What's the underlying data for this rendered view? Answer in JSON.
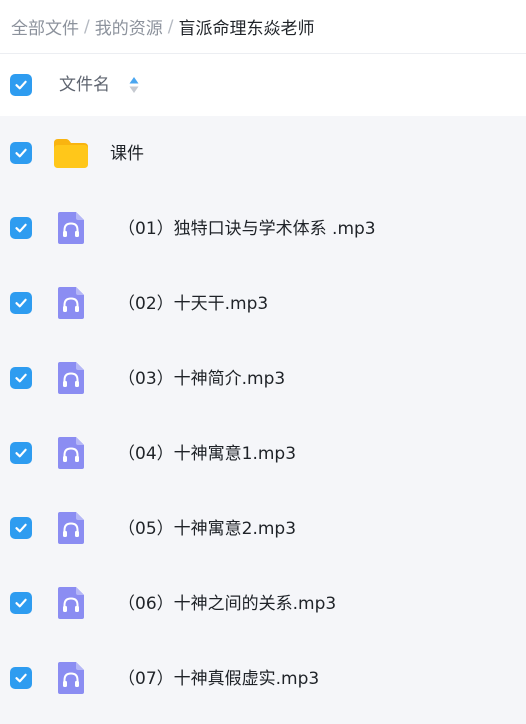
{
  "breadcrumb": {
    "items": [
      "全部文件",
      "我的资源"
    ],
    "current": "盲派命理东焱老师",
    "separator": "/"
  },
  "table": {
    "column_name": "文件名",
    "header_checked": true
  },
  "files": [
    {
      "name": "课件",
      "type": "folder",
      "checked": true,
      "icon": "folder-icon"
    },
    {
      "name": "（01）独特口诀与学术体系 .mp3",
      "type": "audio",
      "checked": true,
      "icon": "audio-file-icon"
    },
    {
      "name": "（02）十天干.mp3",
      "type": "audio",
      "checked": true,
      "icon": "audio-file-icon"
    },
    {
      "name": "（03）十神简介.mp3",
      "type": "audio",
      "checked": true,
      "icon": "audio-file-icon"
    },
    {
      "name": "（04）十神寓意1.mp3",
      "type": "audio",
      "checked": true,
      "icon": "audio-file-icon"
    },
    {
      "name": "（05）十神寓意2.mp3",
      "type": "audio",
      "checked": true,
      "icon": "audio-file-icon"
    },
    {
      "name": "（06）十神之间的关系.mp3",
      "type": "audio",
      "checked": true,
      "icon": "audio-file-icon"
    },
    {
      "name": "（07）十神真假虚实.mp3",
      "type": "audio",
      "checked": true,
      "icon": "audio-file-icon"
    }
  ],
  "colors": {
    "checkbox": "#2e9cf0",
    "folder": "#ffc71a",
    "audio_icon": "#8b8df2",
    "background": "#f5f6f9"
  }
}
